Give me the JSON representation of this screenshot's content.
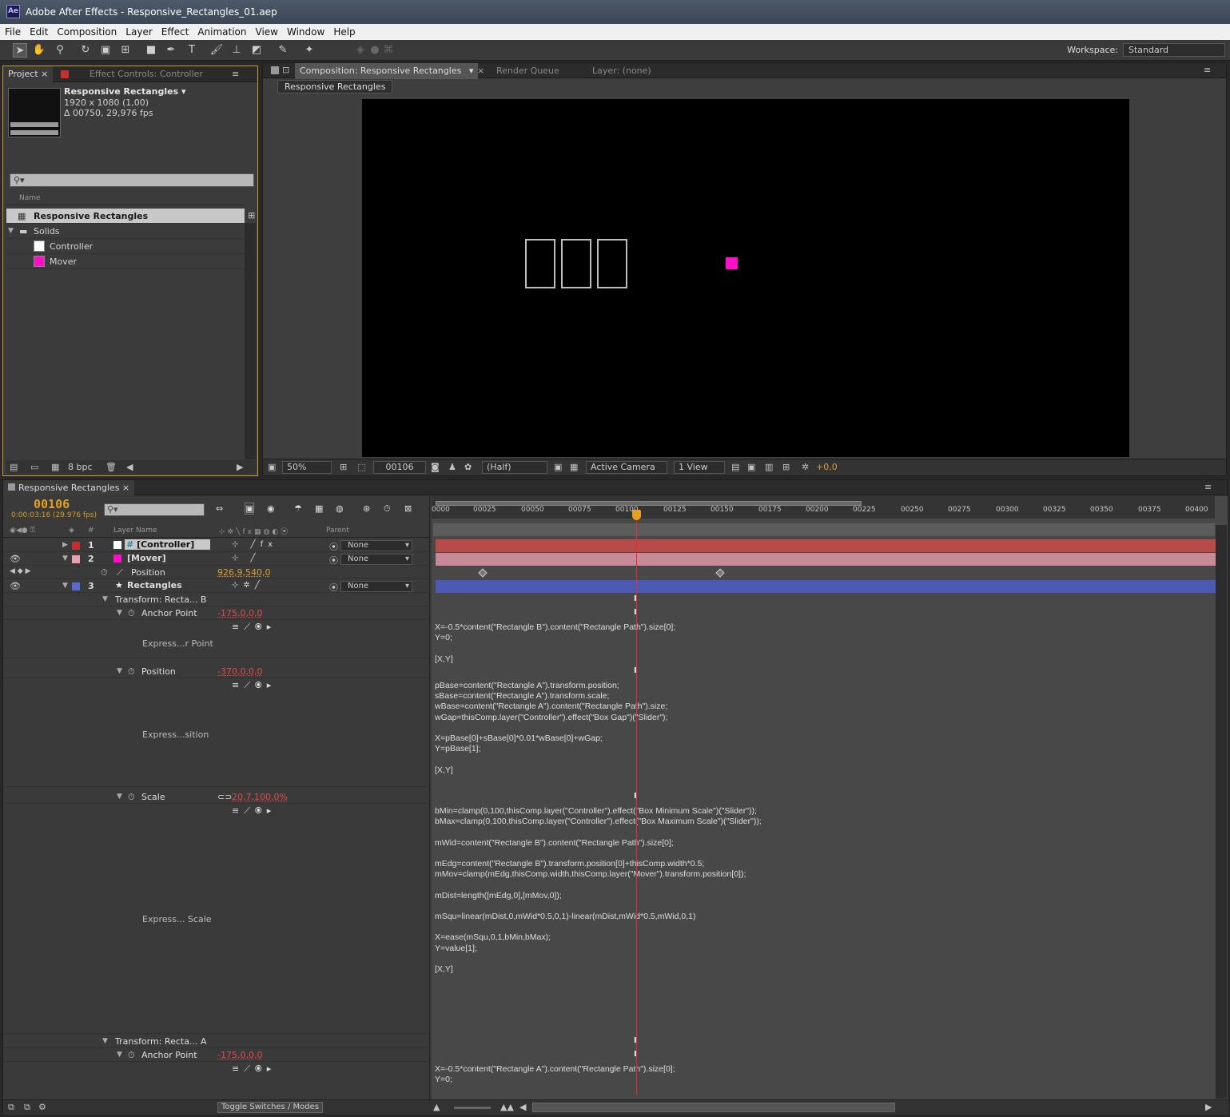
{
  "window": {
    "title": "Adobe After Effects - Responsive_Rectangles_01.aep",
    "logo": "Ae"
  },
  "menu": [
    "File",
    "Edit",
    "Composition",
    "Layer",
    "Effect",
    "Animation",
    "View",
    "Window",
    "Help"
  ],
  "toolbar": {
    "workspace_label": "Workspace:",
    "workspace_value": "Standard"
  },
  "project": {
    "tab_project": "Project",
    "tab_effect_controls": "Effect Controls: Controller",
    "comp_name": "Responsive Rectangles ▾",
    "comp_size": "1920 x 1080 (1,00)",
    "comp_duration": "Δ 00750, 29,976 fps",
    "search_placeholder": "⚲▾",
    "col_name": "Name",
    "items": [
      {
        "label": "Responsive Rectangles"
      },
      {
        "label": "Solids"
      },
      {
        "label": "Controller"
      },
      {
        "label": "Mover"
      }
    ],
    "bpc": "8 bpc"
  },
  "composition": {
    "tab_comp": "Composition: Responsive Rectangles",
    "tab_render": "Render Queue",
    "tab_layer": "Layer: (none)",
    "breadcrumb": "Responsive Rectangles",
    "zoom": "50%",
    "frame": "00106",
    "resolution": "(Half)",
    "camera": "Active Camera",
    "views": "1 View",
    "exposure": "+0,0"
  },
  "timeline": {
    "tab": "Responsive Rectangles",
    "timecode": "00106",
    "timecode_sub": "0:00:03:16 (29.976 fps)",
    "col_layer_name": "Layer Name",
    "col_parent": "Parent",
    "ruler": [
      "0000",
      "00025",
      "00050",
      "00075",
      "00100",
      "00125",
      "00150",
      "00175",
      "00200",
      "00225",
      "00250",
      "00275",
      "00300",
      "00325",
      "00350",
      "00375",
      "00400"
    ],
    "layers": [
      {
        "num": "1",
        "name": "[Controller]",
        "parent": "None"
      },
      {
        "num": "2",
        "name": "[Mover]",
        "parent": "None"
      },
      {
        "num": "3",
        "name": "Rectangles",
        "parent": "None"
      }
    ],
    "props": {
      "mover_position": "Position",
      "mover_position_val": "926,9,540,0",
      "transform_b": "Transform: Recta... B",
      "anchor_b": "Anchor Point",
      "anchor_b_val": "-175,0,0,0",
      "expr_anchor_b": "Express...r Point",
      "position_b": "Position",
      "position_b_val": "-370,0,0,0",
      "expr_position_b": "Express...sition",
      "scale_b": "Scale",
      "scale_b_val": "20,7,100,0%",
      "expr_scale_b": "Express... Scale",
      "transform_a": "Transform: Recta... A",
      "anchor_a": "Anchor Point",
      "anchor_a_val": "-175,0,0,0"
    },
    "expressions": {
      "anchor_b": "X=-0.5*content(\"Rectangle B\").content(\"Rectangle Path\").size[0];\nY=0;\n\n[X,Y]",
      "position_b": "pBase=content(\"Rectangle A\").transform.position;\nsBase=content(\"Rectangle A\").transform.scale;\nwBase=content(\"Rectangle A\").content(\"Rectangle Path\").size;\nwGap=thisComp.layer(\"Controller\").effect(\"Box Gap\")(\"Slider\");\n\nX=pBase[0]+sBase[0]*0.01*wBase[0]+wGap;\nY=pBase[1];\n\n[X,Y]",
      "scale_b": "bMin=clamp(0,100,thisComp.layer(\"Controller\").effect(\"Box Minimum Scale\")(\"Slider\"));\nbMax=clamp(0,100,thisComp.layer(\"Controller\").effect(\"Box Maximum Scale\")(\"Slider\"));\n\nmWid=content(\"Rectangle B\").content(\"Rectangle Path\").size[0];\n\nmEdg=content(\"Rectangle B\").transform.position[0]+thisComp.width*0.5;\nmMov=clamp(mEdg,thisComp.width,thisComp.layer(\"Mover\").transform.position[0]);\n\nmDist=length([mEdg,0],[mMov,0]);\n\nmSqu=linear(mDist,0,mWid*0.5,0,1)-linear(mDist,mWid*0.5,mWid,0,1)\n\nX=ease(mSqu,0,1,bMin,bMax);\nY=value[1];\n\n[X,Y]",
      "anchor_a": "X=-0.5*content(\"Rectangle A\").content(\"Rectangle Path\").size[0];\nY=0;"
    },
    "toggle_label": "Toggle Switches / Modes"
  },
  "colors": {
    "accent": "#e0a020",
    "mover": "#ff10c8",
    "controller_bar": "#b94a4a",
    "mover_bar": "#c88a96",
    "rect_bar": "#4c5ab4"
  }
}
